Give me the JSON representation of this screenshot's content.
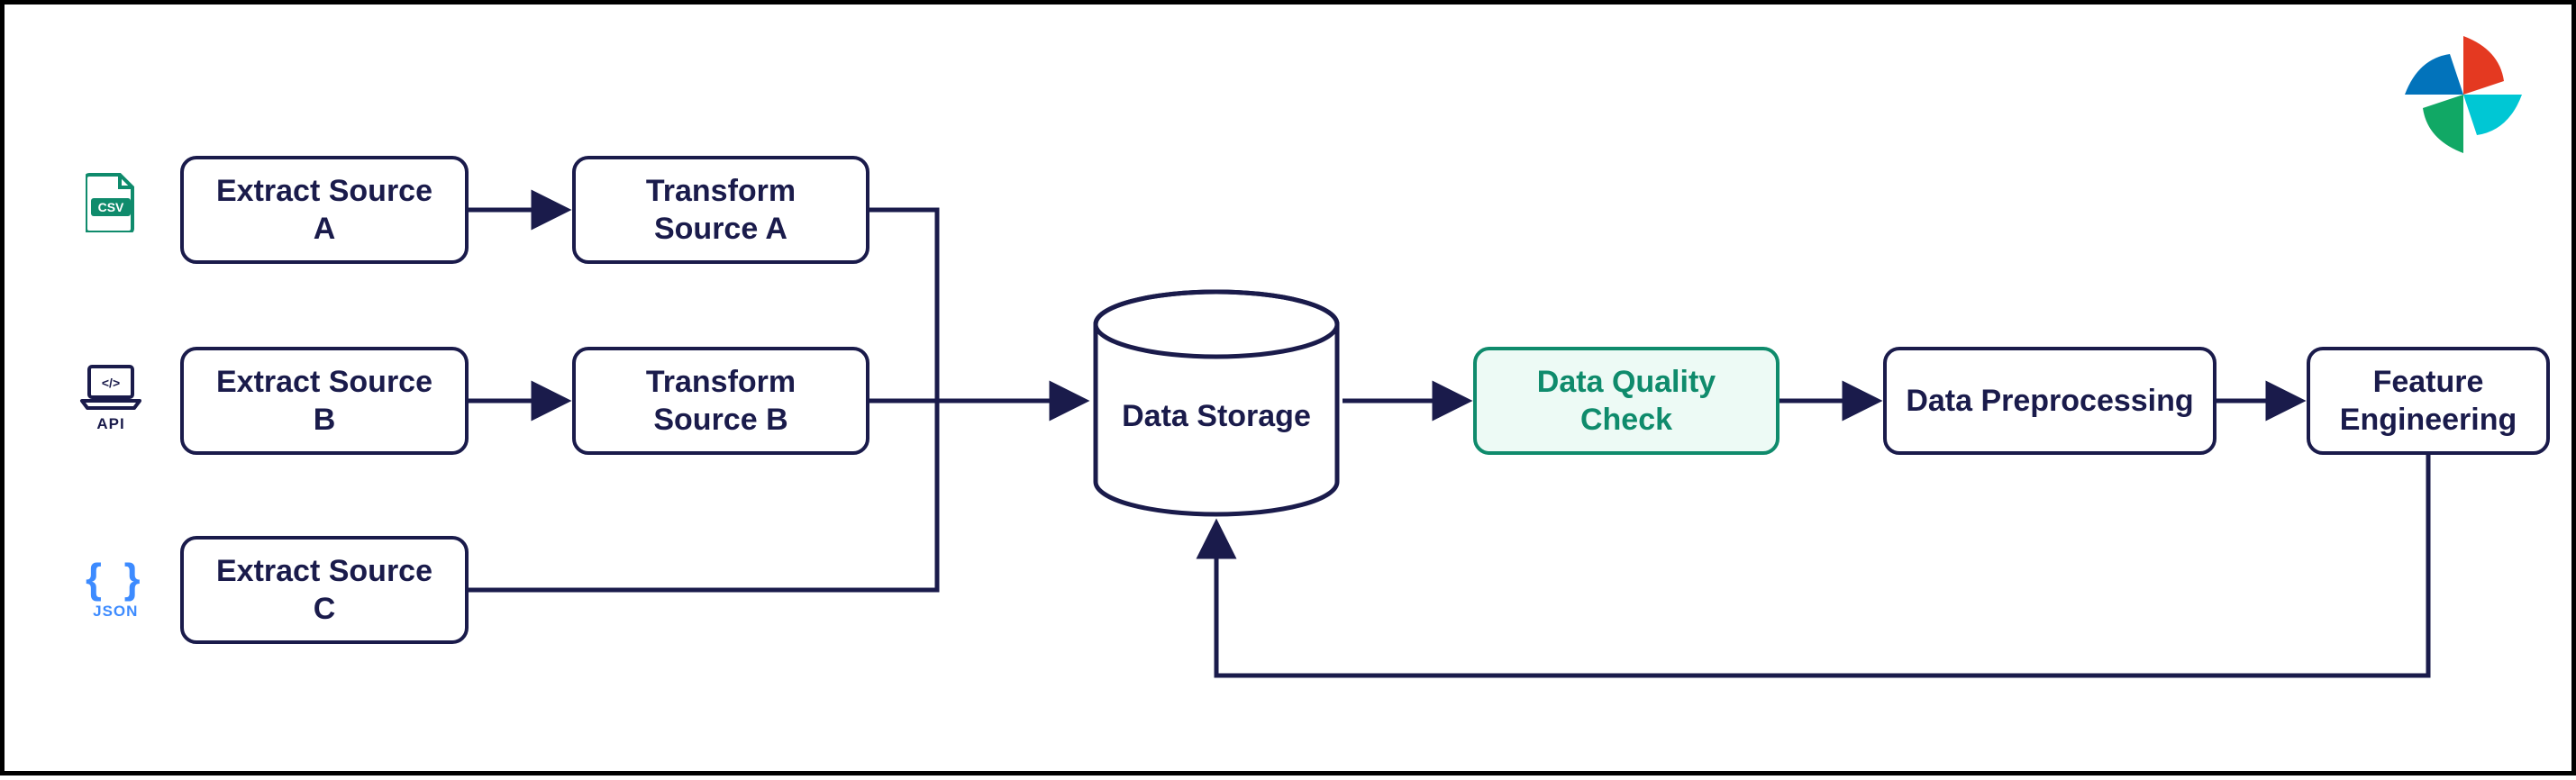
{
  "diagram": {
    "sources": {
      "csv_label": "CSV",
      "api_label": "API",
      "json_label": "JSON"
    },
    "nodes": {
      "extract_a": "Extract Source A",
      "extract_b": "Extract Source B",
      "extract_c": "Extract Source C",
      "transform_a": "Transform Source A",
      "transform_b": "Transform Source B",
      "storage": "Data Storage",
      "quality": "Data Quality Check",
      "preprocess": "Data Preprocessing",
      "feature": "Feature Engineering"
    },
    "colors": {
      "primary": "#1a1b4b",
      "accent_green": "#0f8b6c",
      "accent_bg": "#edfaf5",
      "csv_icon": "#0f8b6c",
      "api_icon": "#1a1b4b",
      "json_icon": "#3d8bff"
    }
  }
}
